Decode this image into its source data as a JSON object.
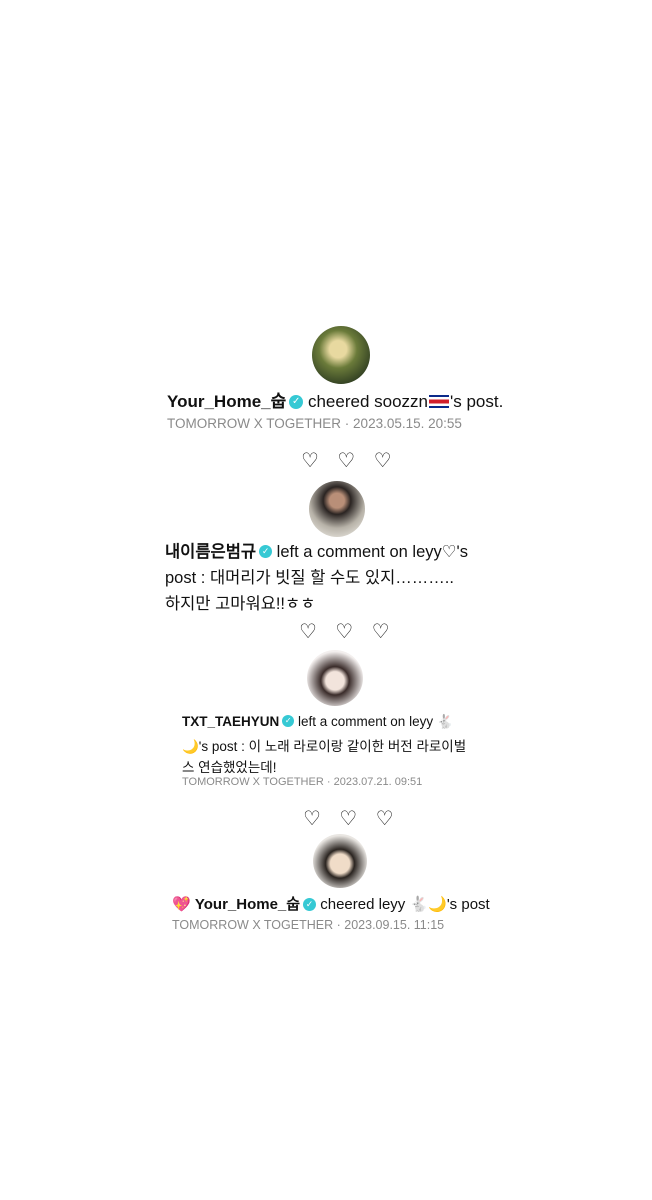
{
  "notifications": [
    {
      "username": "Your_Home_숩",
      "action_text": " cheered soozzn",
      "action_suffix": "'s post.",
      "group": "TOMORROW X TOGETHER",
      "separator": "·",
      "timestamp": "2023.05.15. 20:55"
    },
    {
      "username": "내이름은범규",
      "action_line1": " left a comment on leyy♡'s",
      "action_line2": "post : 대머리가 빗질 할 수도 있지………..",
      "action_line3": "하지만 고마워요!!ㅎㅎ"
    },
    {
      "username": "TXT_TAEHYUN",
      "action_line1": " left a comment on leyy 🐇",
      "action_line2": "🌙's post : 이 노래 라로이랑 같이한 버전 라로이벌",
      "action_line3": "스 연습했었는데!",
      "group": "TOMORROW X TOGETHER",
      "separator": "·",
      "timestamp": "2023.07.21. 09:51"
    },
    {
      "prefix_emoji": "💖",
      "username": "Your_Home_숩",
      "action_text": " cheered leyy 🐇🌙's post",
      "group": "TOMORROW X TOGETHER",
      "separator": "·",
      "timestamp": "2023.09.15. 11:15"
    }
  ],
  "hearts": [
    "♡ ♡ ♡",
    "♡ ♡ ♡",
    "♡ ♡ ♡"
  ],
  "colors": {
    "verified": "#36c9d4",
    "meta": "#8a8a8a"
  }
}
